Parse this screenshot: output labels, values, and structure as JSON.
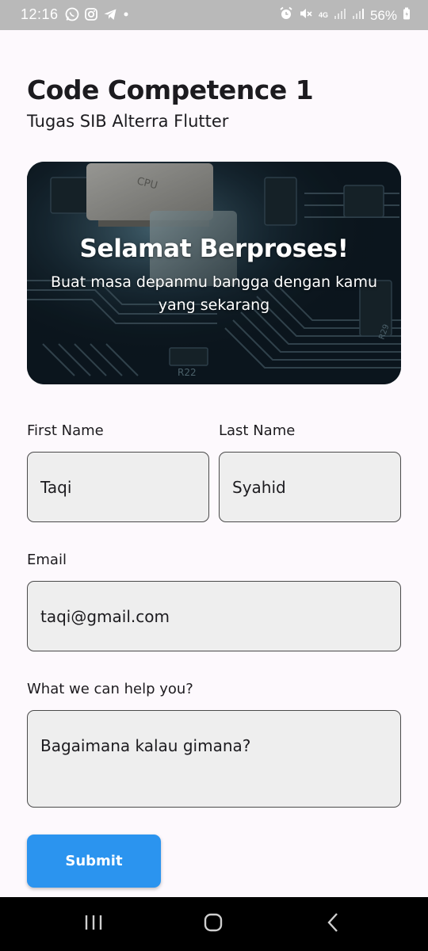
{
  "status_bar": {
    "time": "12:16",
    "battery": "56%",
    "network": "4G"
  },
  "header": {
    "title": "Code Competence 1",
    "subtitle": "Tugas SIB Alterra Flutter"
  },
  "banner": {
    "title": "Selamat Berproses!",
    "text": "Buat masa depanmu bangga dengan kamu yang sekarang",
    "image_labels": {
      "chip": "CPU",
      "resistor_1": "R22",
      "resistor_2": "R29"
    }
  },
  "form": {
    "first_name": {
      "label": "First Name",
      "value": "Taqi"
    },
    "last_name": {
      "label": "Last Name",
      "value": "Syahid"
    },
    "email": {
      "label": "Email",
      "value": "taqi@gmail.com"
    },
    "message": {
      "label": "What we can help you?",
      "value": "Bagaimana kalau gimana?"
    },
    "submit_label": "Submit"
  },
  "nav_bar": {
    "icons": [
      "recent-apps-icon",
      "home-icon",
      "back-icon"
    ]
  },
  "colors": {
    "background": "#fdf9fd",
    "field_background": "#eeeeee",
    "field_border": "#4a4a4a",
    "accent": "#2b94ef",
    "status_bar": "#b9b9b9",
    "nav_bar": "#000000"
  }
}
